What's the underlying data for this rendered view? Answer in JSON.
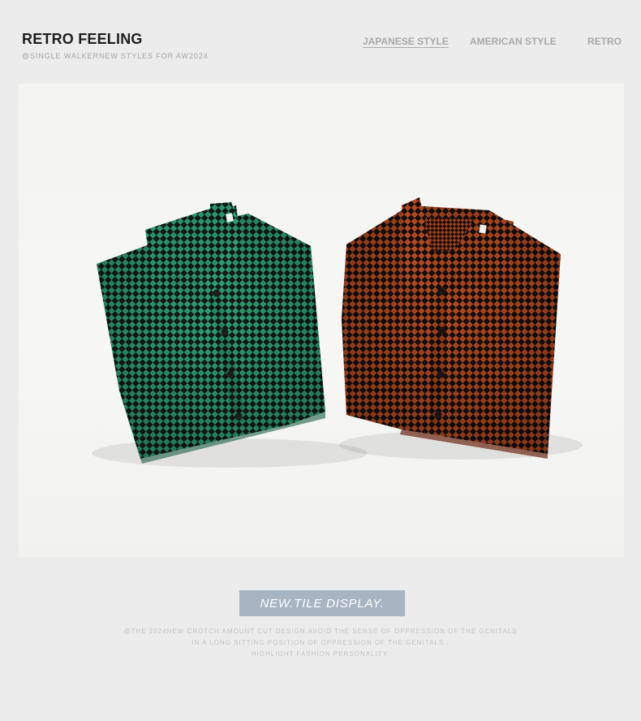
{
  "header": {
    "title": "RETRO FEELING",
    "subtitle": "@SINGLE WALKERNEW STYLES FOR AW2024"
  },
  "nav": {
    "items": [
      {
        "label": "JAPANESE STYLE",
        "active": true
      },
      {
        "label": "AMERICAN STYLE",
        "active": false
      },
      {
        "label": "RETRO",
        "active": false
      }
    ]
  },
  "product_image": {
    "items": [
      "green-checkered-shirt",
      "orange-checkered-shirt"
    ],
    "colors": {
      "background": "#f5f5f3",
      "green_shirt": "#2f9e73",
      "orange_shirt": "#b04a22",
      "check_dark": "#101a16"
    }
  },
  "tag": {
    "label": "NEW.TILE DISPLAY.",
    "color": "#a7b4c2"
  },
  "caption": {
    "lines": [
      "@THE 2024NEW CROTCH AMOUNT CUT DESIGN.AVOID THE SENSE OF OPPRESSION OF THE GENITALS",
      "IN A LONG SITTING POSITION OF OPPRESSION OF THE GENITALS .",
      "HIGHLIGHT FASHION PERSONALITY."
    ]
  }
}
